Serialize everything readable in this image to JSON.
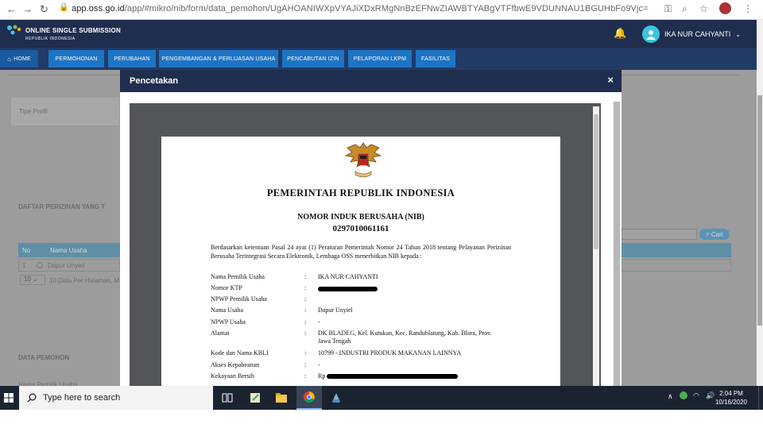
{
  "browser": {
    "url_host": "app.oss.go.id",
    "url_path": "/app/#mikro/nib/form/data_pemohon/UgAHOANIWXpVYAJiXDxRMgNnBzEFNwZIAWBTYABgVTFfbwE9VDUNNAU1BGUHbFo9Vjc="
  },
  "app": {
    "logo_line1": "ONLINE SINGLE SUBMISSION",
    "logo_line2": "REPUBLIK INDONESIA",
    "user_name": "IKA NUR CAHYANTI"
  },
  "nav": {
    "items": [
      {
        "label": "HOME"
      },
      {
        "label": "PERMOHONAN"
      },
      {
        "label": "PERUBAHAN"
      },
      {
        "label": "PENGEMBANGAN & PERLUASAN USAHA"
      },
      {
        "label": "PENCABUTAN IZIN"
      },
      {
        "label": "PELAPORAN LKPM"
      },
      {
        "label": "FASILITAS"
      }
    ]
  },
  "background": {
    "tipe_label": "Tipe Profil",
    "section1": "DAFTAR PERIZINAN YANG T",
    "search_btn": "Cari",
    "table_no": "No",
    "table_name": "Nama Usaha",
    "row_no": "1",
    "row_name": "Dapur Unyiel",
    "per_page": "10",
    "per_page_text": "10 Data Per Halaman, M",
    "section2": "DATA PEMOHON",
    "field1": "Nama Pemilik Usaha"
  },
  "modal": {
    "title": "Pencetakan",
    "close": "×"
  },
  "doc": {
    "gov_title": "PEMERINTAH REPUBLIK INDONESIA",
    "nib_title": "NOMOR INDUK BERUSAHA (NIB)",
    "nib_number": "0297010061161",
    "intro": "Berdasarkan ketentuan Pasal 24 ayat (1) Peraturan Pemerintah Nomor 24 Tahun 2018 tentang Pelayanan Perizinan Berusaha Terintegrasi Secara Elektronik, Lembaga OSS menerbitkan NIB kepada :",
    "fields": [
      {
        "label": "Nama Pemilik Usaha",
        "value": "IKA NUR CAHYANTI"
      },
      {
        "label": "Nomor KTP",
        "value": ""
      },
      {
        "label": "NPWP Pemilik Usaha",
        "value": ""
      },
      {
        "label": "Nama Usaha",
        "value": "Dapur Unyiel"
      },
      {
        "label": "NPWP Usaha",
        "value": "-"
      },
      {
        "label": "Alamat",
        "value": "DK BLADEG, Kel. Kutukan, Kec. Randublatung, Kab. Blora, Prov.",
        "value2": "Jawa Tengah"
      },
      {
        "label": "Kode dan Nama KBLI",
        "value": "10799 - INDUSTRI PRODUK MAKANAN LAINNYA"
      },
      {
        "label": "Akses Kepabeanan",
        "value": "-"
      },
      {
        "label": "Kekayaan Bersih",
        "value": "Rp"
      }
    ]
  },
  "taskbar": {
    "search_placeholder": "Type here to search",
    "time": "2:04 PM",
    "date": "10/16/2020"
  },
  "colors": {
    "header": "#1f2d4e",
    "navbar": "#223a66",
    "nav_button": "#1e74c4",
    "accent": "#37c5e0"
  }
}
